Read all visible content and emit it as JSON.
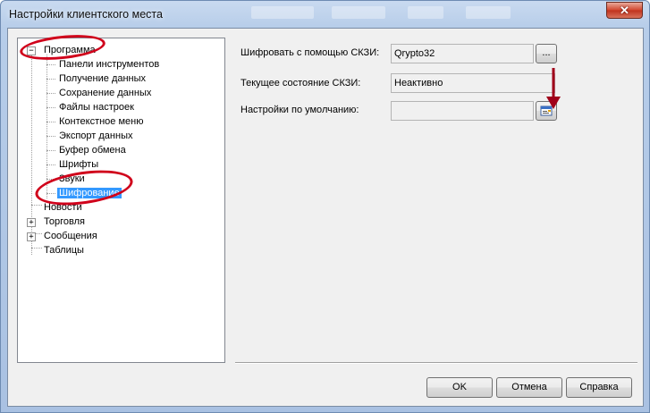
{
  "window": {
    "title": "Настройки клиентского места",
    "close_glyph": "✕"
  },
  "tree": {
    "root": {
      "label": "Программа",
      "expander": "−"
    },
    "children": [
      "Панели инструментов",
      "Получение данных",
      "Сохранение данных",
      "Файлы настроек",
      "Контекстное меню",
      "Экспорт данных",
      "Буфер обмена",
      "Шрифты",
      "Звуки",
      "Шифрование"
    ],
    "selected": "Шифрование",
    "top_level": [
      {
        "label": "Новости",
        "expander": ""
      },
      {
        "label": "Торговля",
        "expander": "+"
      },
      {
        "label": "Сообщения",
        "expander": "+"
      },
      {
        "label": "Таблицы",
        "expander": ""
      }
    ]
  },
  "settings": {
    "encrypt_label": "Шифровать с помощью СКЗИ:",
    "encrypt_value": "Qrypto32",
    "browse_label": "...",
    "state_label": "Текущее состояние СКЗИ:",
    "state_value": "Неактивно",
    "defaults_label": "Настройки по умолчанию:",
    "defaults_value": "",
    "defaults_icon": "settings-dialog-icon"
  },
  "buttons": {
    "ok": "OK",
    "cancel": "Отмена",
    "help": "Справка"
  },
  "annotation_color": "#d0021b"
}
